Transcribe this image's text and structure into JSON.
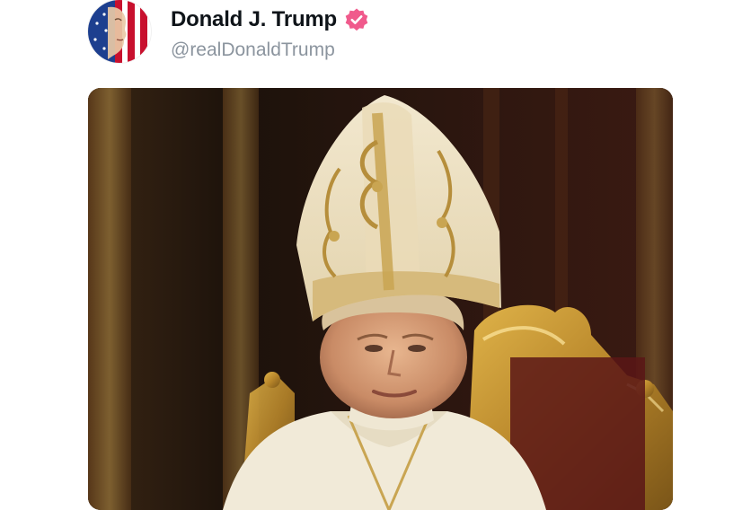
{
  "post": {
    "author": {
      "display_name": "Donald J. Trump",
      "handle": "@realDonaldTrump",
      "verified": true,
      "avatar_icon": "flag-face-avatar",
      "verified_icon": "verified-badge-icon"
    },
    "media": {
      "type": "image",
      "subject": "pope-portrait-image"
    }
  },
  "colors": {
    "name_text": "#0f1419",
    "handle_text": "#8b949e",
    "verified_badge": "#f05a8c",
    "background": "#ffffff"
  }
}
